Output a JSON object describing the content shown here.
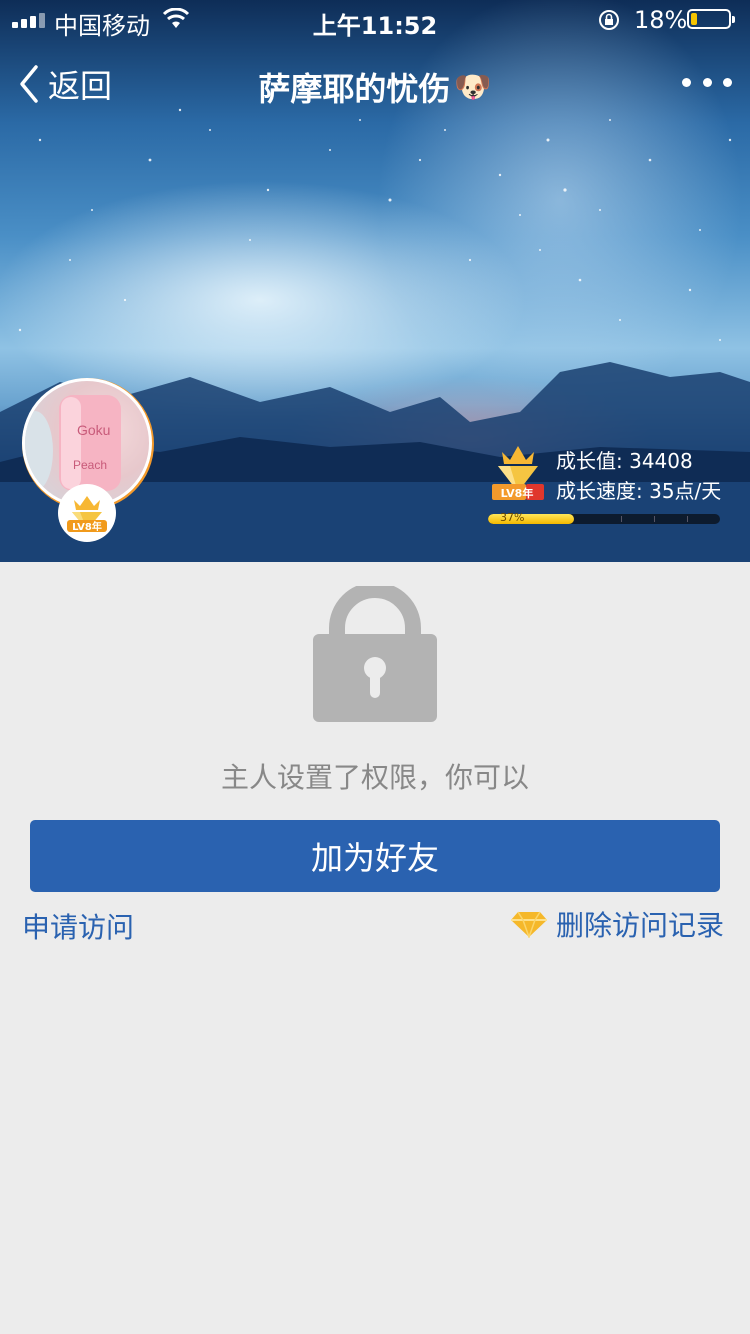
{
  "status_bar": {
    "carrier": "中国移动",
    "time": "上午11:52",
    "battery_percent": "18%",
    "battery_level": 0.18,
    "battery_color": "#f5c400"
  },
  "nav": {
    "back_label": "返回",
    "title": "萨摩耶的忧伤",
    "title_emoji": "🐶"
  },
  "profile": {
    "avatar_text_1": "Goku",
    "avatar_text_2": "Peach",
    "badge_label": "LV8年"
  },
  "growth": {
    "vip_badge_label": "LV8年",
    "value_text": "成长值: 34408",
    "speed_text": "成长速度: 35点/天",
    "progress_percent": 37,
    "progress_label": "37%"
  },
  "content": {
    "permission_text": "主人设置了权限，你可以",
    "add_friend_label": "加为好友",
    "apply_visit_label": "申请访问",
    "delete_records_label": "删除访问记录"
  },
  "colors": {
    "accent_blue": "#2a62b0",
    "page_bg": "#ececec",
    "lock_gray": "#b3b3b3",
    "avatar_ring": "#f39a2c"
  },
  "icons": [
    "signal-icon",
    "wifi-icon",
    "rotation-lock-icon",
    "battery-icon",
    "back-chevron-icon",
    "more-icon",
    "crown-diamond-icon",
    "lock-icon",
    "diamond-icon"
  ]
}
